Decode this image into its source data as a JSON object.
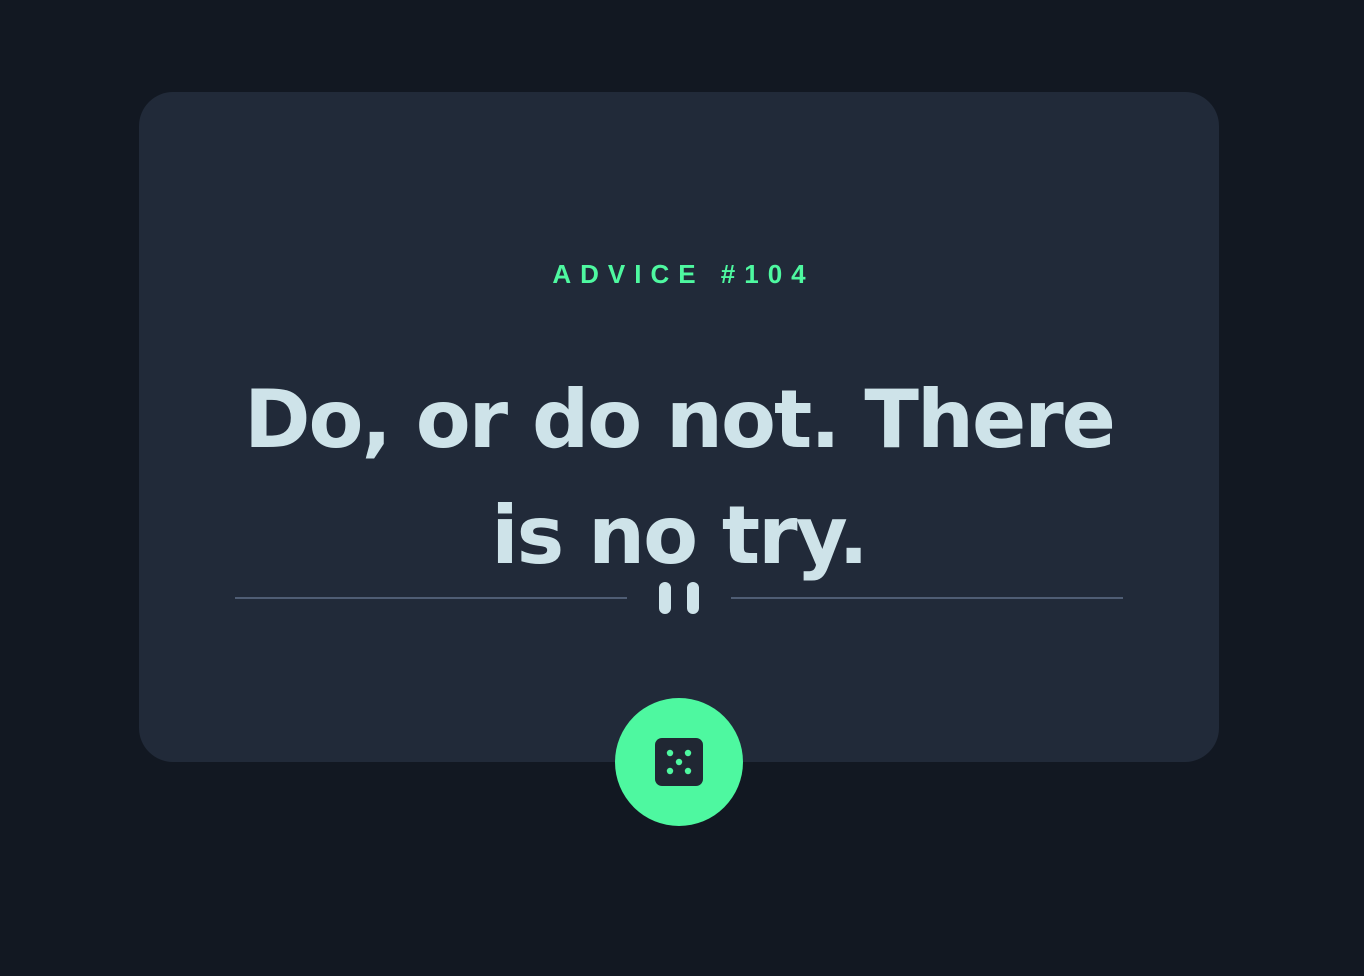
{
  "advice": {
    "id_label": "ADVICE #104",
    "text": "Do, or do not. There is no try."
  },
  "divider": {
    "icon": "pause-icon"
  },
  "actions": {
    "generate_icon": "dice-icon"
  },
  "colors": {
    "background": "#121822",
    "card": "#212A39",
    "accent": "#4EF8A0",
    "text": "#CEE3E9",
    "divider": "#4F5D74"
  }
}
